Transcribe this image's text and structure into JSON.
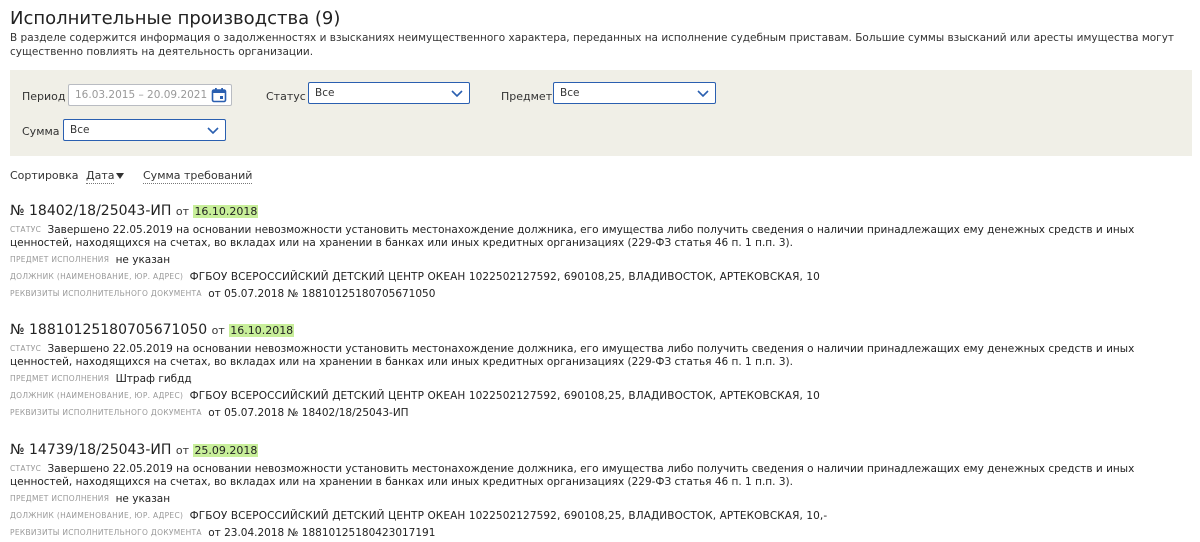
{
  "page": {
    "title": "Исполнительные производства (9)",
    "description": "В разделе содержится информация о задолженностях и взысканиях неимущественного характера, переданных на исполнение судебным приставам. Большие суммы взысканий или аресты имущества могут существенно повлиять на деятельность организации."
  },
  "filters": {
    "period_label": "Период",
    "period_value": "16.03.2015 – 20.09.2021",
    "status_label": "Статус",
    "status_value": "Все",
    "subject_label": "Предмет",
    "subject_value": "Все",
    "sum_label": "Сумма",
    "sum_value": "Все"
  },
  "sort": {
    "label": "Сортировка",
    "options": [
      "Дата",
      "Сумма требований"
    ]
  },
  "labels": {
    "status": "статус",
    "subject": "предмет исполнения",
    "debtor": "должник (наименование, юр. адрес)",
    "requisites": "реквизиты исполнительного документа",
    "from": "от"
  },
  "cases": [
    {
      "number": "№ 18402/18/25043-ИП",
      "date": "16.10.2018",
      "status": "Завершено 22.05.2019 на основании невозможности установить местонахождение должника, его имущества либо получить сведения о наличии принадлежащих ему денежных средств и иных ценностей, находящихся на счетах, во вкладах или на хранении в банках или иных кредитных организациях (229-ФЗ статья 46 п. 1 п.п. 3).",
      "subject": "не указан",
      "debtor": "ФГБОУ ВСЕРОССИЙСКИЙ ДЕТСКИЙ ЦЕНТР ОКЕАН 1022502127592, 690108,25, ВЛАДИВОСТОК, АРТЕКОВСКАЯ, 10",
      "requisites": "от 05.07.2018 № 18810125180705671050"
    },
    {
      "number": "№ 18810125180705671050",
      "date": "16.10.2018",
      "status": "Завершено 22.05.2019 на основании невозможности установить местонахождение должника, его имущества либо получить сведения о наличии принадлежащих ему денежных средств и иных ценностей, находящихся на счетах, во вкладах или на хранении в банках или иных кредитных организациях (229-ФЗ статья 46 п. 1 п.п. 3).",
      "subject": "Штраф гибдд",
      "debtor": "ФГБОУ ВСЕРОССИЙСКИЙ ДЕТСКИЙ ЦЕНТР ОКЕАН 1022502127592, 690108,25, ВЛАДИВОСТОК, АРТЕКОВСКАЯ, 10",
      "requisites": "от 05.07.2018 № 18402/18/25043-ИП"
    },
    {
      "number": "№ 14739/18/25043-ИП",
      "date": "25.09.2018",
      "status": "Завершено 22.05.2019 на основании невозможности установить местонахождение должника, его имущества либо получить сведения о наличии принадлежащих ему денежных средств и иных ценностей, находящихся на счетах, во вкладах или на хранении в банках или иных кредитных организациях (229-ФЗ статья 46 п. 1 п.п. 3).",
      "subject": "не указан",
      "debtor": "ФГБОУ ВСЕРОССИЙСКИЙ ДЕТСКИЙ ЦЕНТР ОКЕАН 1022502127592, 690108,25, ВЛАДИВОСТОК, АРТЕКОВСКАЯ, 10,-",
      "requisites": "от 23.04.2018 № 18810125180423017191"
    }
  ]
}
